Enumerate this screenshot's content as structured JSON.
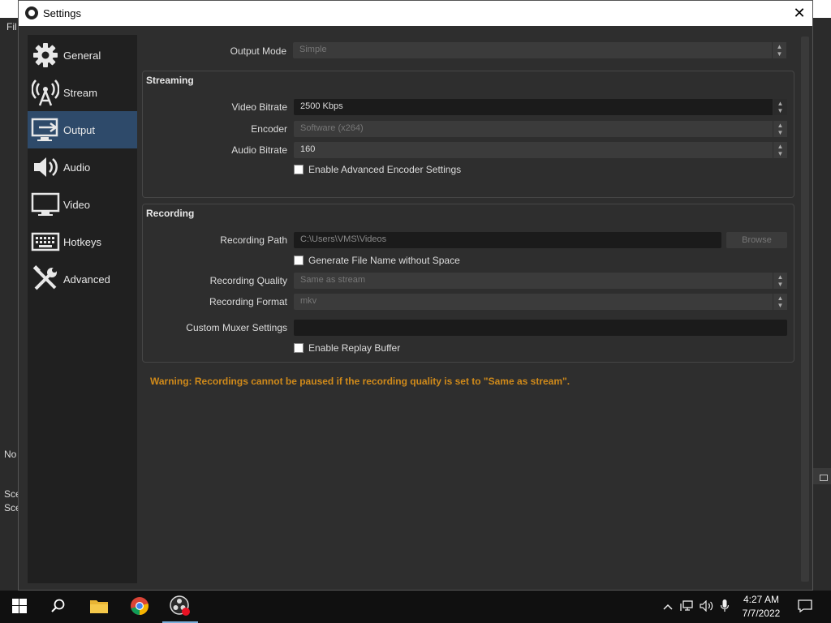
{
  "background": {
    "menu_fragment": "Fil",
    "left_fragments": [
      "No",
      "Sce",
      "Sce"
    ]
  },
  "window": {
    "title": "Settings",
    "close_symbol": "✕"
  },
  "sidebar": {
    "items": [
      {
        "label": "General",
        "icon": "gear-icon"
      },
      {
        "label": "Stream",
        "icon": "antenna-icon"
      },
      {
        "label": "Output",
        "icon": "output-icon",
        "active": true
      },
      {
        "label": "Audio",
        "icon": "speaker-icon"
      },
      {
        "label": "Video",
        "icon": "monitor-icon"
      },
      {
        "label": "Hotkeys",
        "icon": "keyboard-icon"
      },
      {
        "label": "Advanced",
        "icon": "tools-icon"
      }
    ]
  },
  "output": {
    "mode_label": "Output Mode",
    "mode_value": "Simple",
    "streaming": {
      "title": "Streaming",
      "video_bitrate_label": "Video Bitrate",
      "video_bitrate_value": "2500 Kbps",
      "encoder_label": "Encoder",
      "encoder_value": "Software (x264)",
      "audio_bitrate_label": "Audio Bitrate",
      "audio_bitrate_value": "160",
      "advanced_encoder_label": "Enable Advanced Encoder Settings"
    },
    "recording": {
      "title": "Recording",
      "path_label": "Recording Path",
      "path_value": "C:\\Users\\VMS\\Videos",
      "browse_label": "Browse",
      "no_space_label": "Generate File Name without Space",
      "quality_label": "Recording Quality",
      "quality_value": "Same as stream",
      "format_label": "Recording Format",
      "format_value": "mkv",
      "muxer_label": "Custom Muxer Settings",
      "muxer_value": "",
      "replay_label": "Enable Replay Buffer"
    },
    "warning": "Warning: Recordings cannot be paused if the recording quality is set to \"Same as stream\"."
  },
  "taskbar": {
    "time": "4:27 AM",
    "date": "7/7/2022",
    "apps": [
      "start-icon",
      "search-icon",
      "file-explorer-icon",
      "chrome-icon",
      "obs-icon"
    ],
    "colors": {
      "accent": "#7aaeda",
      "warning": "#d08a1a",
      "active_nav": "#2e4a6a"
    }
  }
}
